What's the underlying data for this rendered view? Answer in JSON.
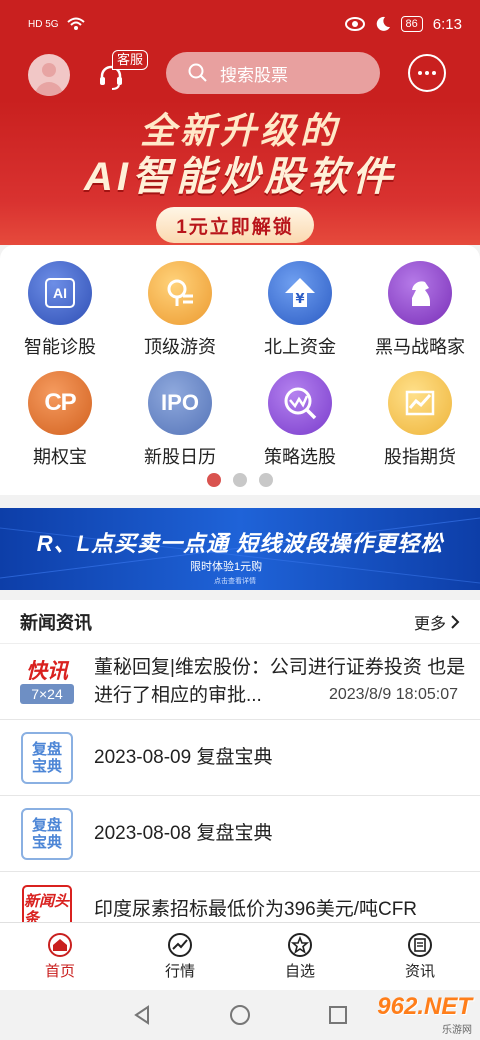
{
  "status_bar": {
    "network": "HD 5G",
    "battery": "86",
    "time": "6:13"
  },
  "header": {
    "service_label": "客服",
    "search_placeholder": "搜索股票"
  },
  "banner": {
    "line1": "全新升级的",
    "line2": "AI智能炒股软件",
    "button": "1元立即解锁"
  },
  "grid": {
    "items": [
      {
        "label": "智能诊股",
        "icon": "ai-chip-icon",
        "icon_text": "AI",
        "color": "#3b5fc6"
      },
      {
        "label": "顶级游资",
        "icon": "coin-magnifier-icon",
        "icon_text": "",
        "color": "#f0a43a"
      },
      {
        "label": "北上资金",
        "icon": "yuan-up-arrow-icon",
        "icon_text": "¥",
        "color": "#3c6fd0"
      },
      {
        "label": "黑马战略家",
        "icon": "chess-horse-icon",
        "icon_text": "",
        "color": "#8a3fc4"
      },
      {
        "label": "期权宝",
        "icon": "cp-icon",
        "icon_text": "CP",
        "color": "#e07634"
      },
      {
        "label": "新股日历",
        "icon": "ipo-icon",
        "icon_text": "IPO",
        "color": "#6d8ac9"
      },
      {
        "label": "策略选股",
        "icon": "strategy-search-icon",
        "icon_text": "",
        "color": "#8a47d6"
      },
      {
        "label": "股指期货",
        "icon": "index-chart-icon",
        "icon_text": "",
        "color": "#f1c04a"
      }
    ],
    "page_count": 3,
    "active_page": 1
  },
  "ad": {
    "title": "R、L点买卖一点通  短线波段操作更轻松",
    "subtitle": "限时体验1元购",
    "tiny": "点击查看详情"
  },
  "news": {
    "title": "新闻资讯",
    "more_label": "更多",
    "items": [
      {
        "icon": "kuaixun-icon",
        "badge1": "快讯",
        "badge2": "7×24",
        "text": "董秘回复|维宏股份：公司进行证券投资 也是进行了相应的审批...",
        "time": "2023/8/9 18:05:07"
      },
      {
        "icon": "fupan-icon",
        "badge1": "复盘宝典",
        "text": "2023-08-09 复盘宝典"
      },
      {
        "icon": "fupan-icon",
        "badge1": "复盘宝典",
        "text": "2023-08-08 复盘宝典"
      },
      {
        "icon": "xinwen-icon",
        "badge1": "新闻头条",
        "text": "印度尿素招标最低价为396美元/吨CFR"
      }
    ]
  },
  "bottom_nav": [
    {
      "label": "首页",
      "icon": "home-icon",
      "active": true
    },
    {
      "label": "行情",
      "icon": "market-chart-icon",
      "active": false
    },
    {
      "label": "自选",
      "icon": "star-icon",
      "active": false
    },
    {
      "label": "资讯",
      "icon": "news-list-icon",
      "active": false
    }
  ],
  "watermark": {
    "text": "962.NET",
    "sub": "乐游网"
  },
  "colors": {
    "brand_red": "#c9201f",
    "accent_blue": "#1f63d8"
  }
}
